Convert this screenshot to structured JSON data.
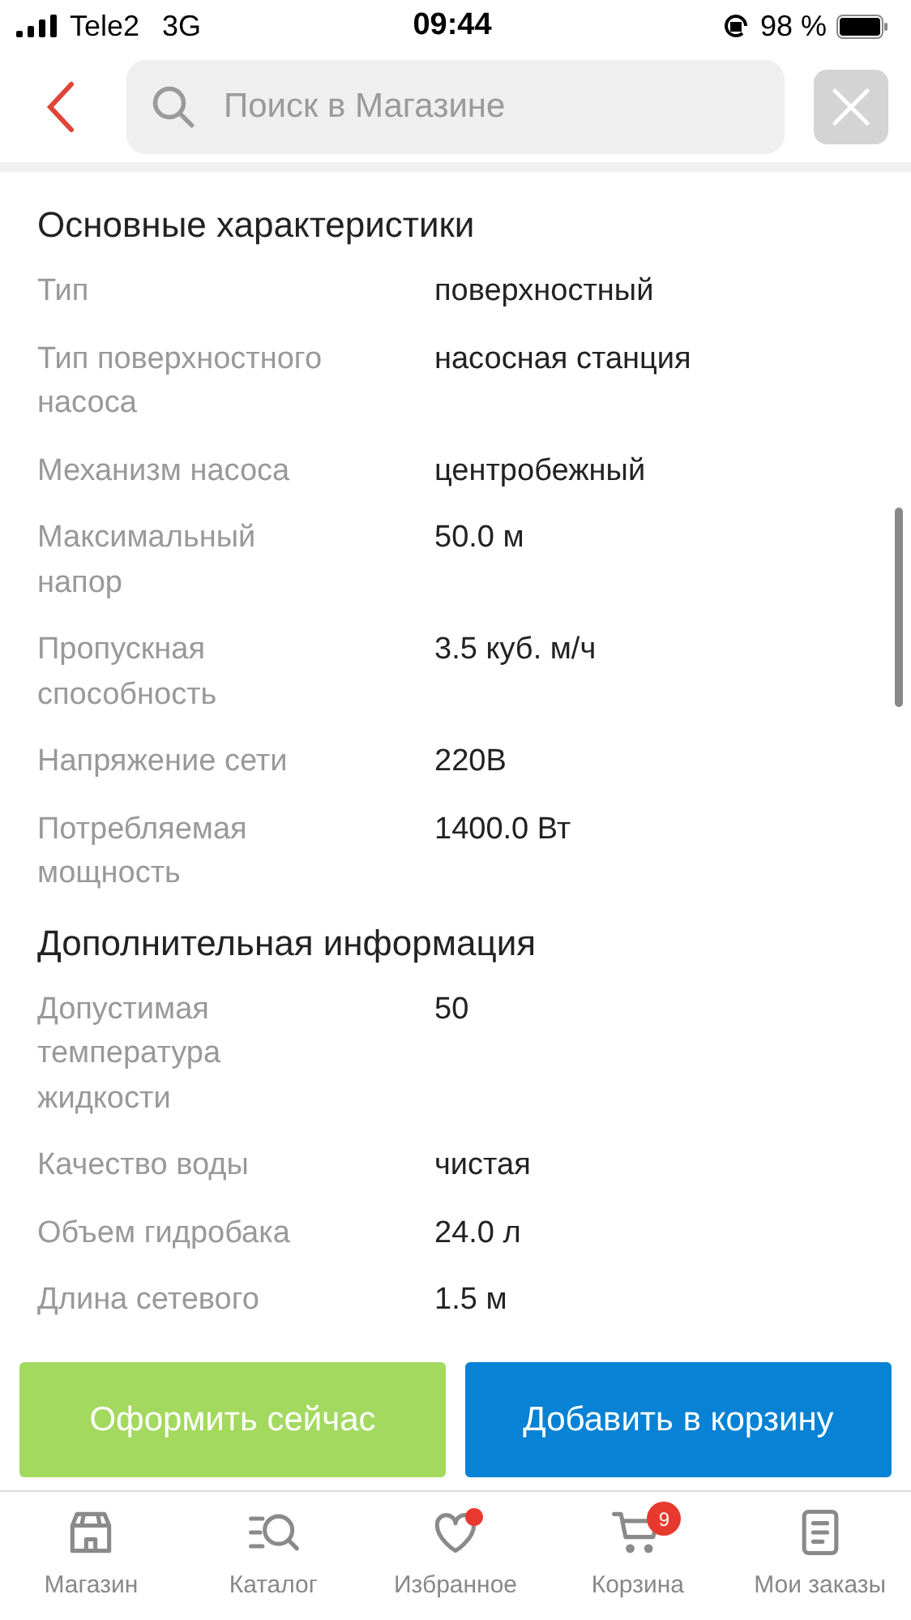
{
  "status_bar": {
    "carrier": "Tele2",
    "network": "3G",
    "time": "09:44",
    "battery": "98 %"
  },
  "header": {
    "search": {
      "placeholder": "Поиск в Магазине"
    }
  },
  "sections": [
    {
      "title": "Основные характеристики",
      "rows": [
        {
          "label": "Тип",
          "value": "поверхностный"
        },
        {
          "label": "Тип поверхностного насоса",
          "value": "насосная станция"
        },
        {
          "label": "Механизм насоса",
          "value": "центробежный"
        },
        {
          "label": "Максимальный напор",
          "value": "50.0 м"
        },
        {
          "label": "Пропускная способность",
          "value": "3.5 куб. м/ч"
        },
        {
          "label": "Напряжение сети",
          "value": "220В"
        },
        {
          "label": "Потребляемая мощность",
          "value": "1400.0 Вт"
        }
      ]
    },
    {
      "title": "Дополнительная информация",
      "rows": [
        {
          "label": "Допустимая температура жидкости",
          "value": "50"
        },
        {
          "label": "Качество воды",
          "value": "чистая"
        },
        {
          "label": "Объем гидробака",
          "value": "24.0 л"
        },
        {
          "label": "Длина сетевого",
          "value": "1.5 м"
        }
      ]
    }
  ],
  "actions": [
    {
      "kind": "checkout",
      "label": "Оформить сейчас"
    },
    {
      "kind": "cart",
      "label": "Добавить в корзину"
    }
  ],
  "tab_bar": [
    {
      "kind": "store",
      "label": "Магазин"
    },
    {
      "kind": "catalog",
      "label": "Каталог"
    },
    {
      "kind": "heart",
      "label": "Избранное",
      "dot": true
    },
    {
      "kind": "cart",
      "label": "Корзина",
      "count": "9"
    },
    {
      "kind": "orders",
      "label": "Мои заказы"
    }
  ]
}
